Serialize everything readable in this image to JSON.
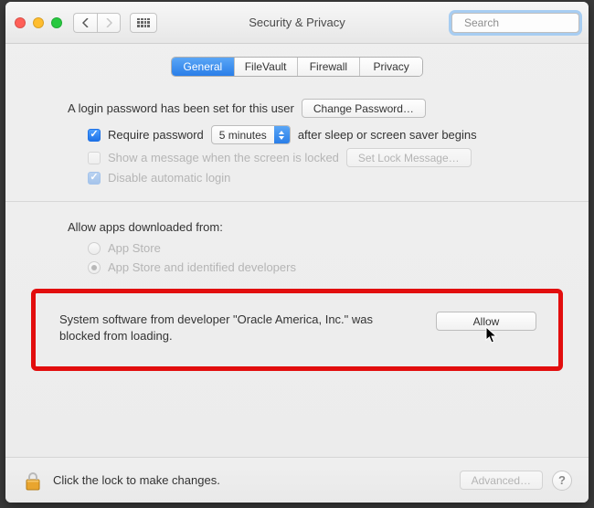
{
  "titlebar": {
    "title": "Security & Privacy",
    "search_placeholder": "Search"
  },
  "tabs": {
    "general": "General",
    "filevault": "FileVault",
    "firewall": "Firewall",
    "privacy": "Privacy"
  },
  "section1": {
    "login_pw_text": "A login password has been set for this user",
    "change_pw_label": "Change Password…",
    "require_pw_label": "Require password",
    "require_pw_delay": "5 minutes",
    "require_pw_after": "after sleep or screen saver begins",
    "show_msg_label": "Show a message when the screen is locked",
    "set_lock_msg_label": "Set Lock Message…",
    "disable_auto_login_label": "Disable automatic login"
  },
  "section2": {
    "allow_apps_label": "Allow apps downloaded from:",
    "radio_app_store": "App Store",
    "radio_identified": "App Store and identified developers"
  },
  "blocked": {
    "message": "System software from developer \"Oracle America, Inc.\" was blocked from loading.",
    "allow_label": "Allow"
  },
  "footer": {
    "lock_text": "Click the lock to make changes.",
    "advanced_label": "Advanced…"
  }
}
